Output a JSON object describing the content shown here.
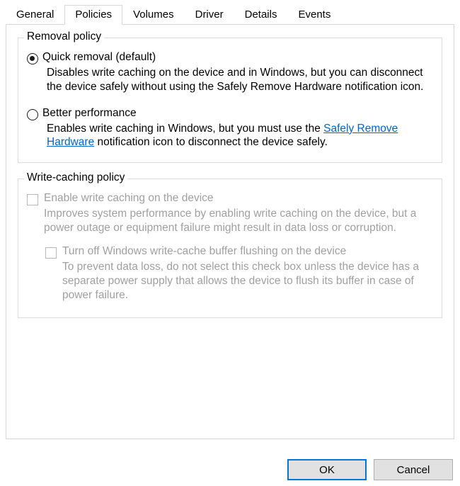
{
  "tabs": [
    {
      "label": "General"
    },
    {
      "label": "Policies"
    },
    {
      "label": "Volumes"
    },
    {
      "label": "Driver"
    },
    {
      "label": "Details"
    },
    {
      "label": "Events"
    }
  ],
  "removal": {
    "title": "Removal policy",
    "quick_label": "Quick removal (default)",
    "quick_desc": "Disables write caching on the device and in Windows, but you can disconnect the device safely without using the Safely Remove Hardware notification icon.",
    "better_label": "Better performance",
    "better_desc_pre": "Enables write caching in Windows, but you must use the ",
    "link_text": "Safely Remove Hardware",
    "better_desc_post": " notification icon to disconnect the device safely."
  },
  "writecache": {
    "title": "Write-caching policy",
    "enable_label": "Enable write caching on the device",
    "enable_desc": "Improves system performance by enabling write caching on the device, but a power outage or equipment failure might result in data loss or corruption.",
    "flush_label": "Turn off Windows write-cache buffer flushing on the device",
    "flush_desc": "To prevent data loss, do not select this check box unless the device has a separate power supply that allows the device to flush its buffer in case of power failure."
  },
  "buttons": {
    "ok": "OK",
    "cancel": "Cancel"
  }
}
